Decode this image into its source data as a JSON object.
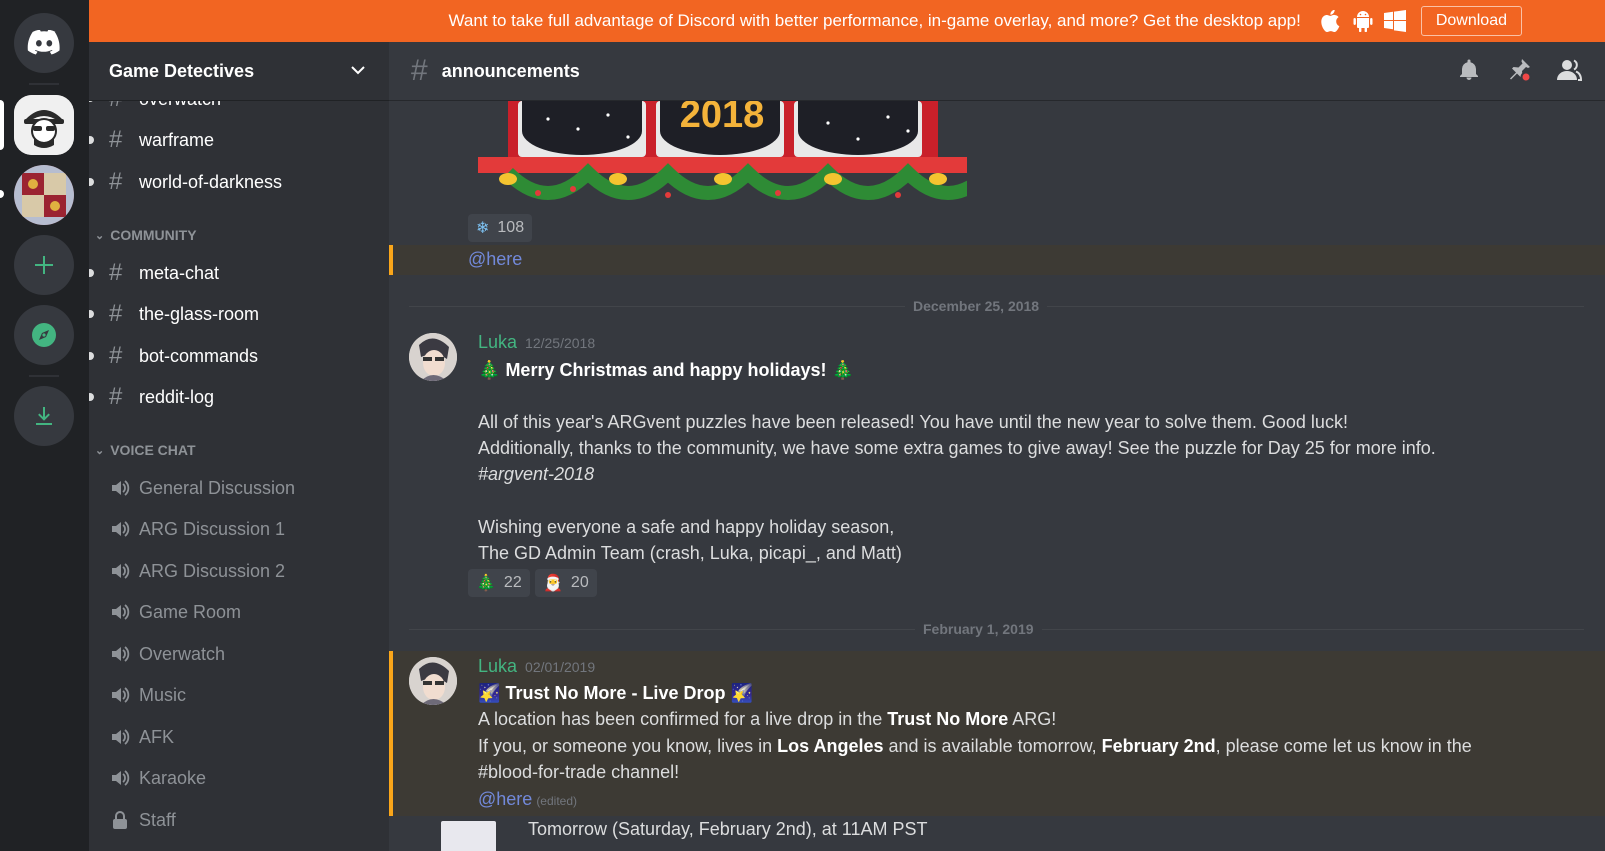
{
  "banner": {
    "text": "Want to take full advantage of Discord with better performance, in-game overlay, and more? Get the desktop app!",
    "download_label": "Download"
  },
  "server": {
    "name": "Game Detectives"
  },
  "channels": {
    "partial_top": "overwatch",
    "text_top": [
      "warframe",
      "world-of-darkness"
    ],
    "community_category": "COMMUNITY",
    "community": [
      "meta-chat",
      "the-glass-room",
      "bot-commands",
      "reddit-log"
    ],
    "voice_category": "VOICE CHAT",
    "voice": [
      "General Discussion",
      "ARG Discussion 1",
      "ARG Discussion 2",
      "Game Room",
      "Overwatch",
      "Music",
      "AFK",
      "Karaoke",
      "Staff"
    ]
  },
  "chat": {
    "channel_name": "announcements",
    "image_text": "2018",
    "reaction_top": {
      "emoji": "❄",
      "count": "108"
    },
    "here_top": "@here",
    "divider1": "December 25, 2018",
    "msg1": {
      "author": "Luka",
      "timestamp": "12/25/2018",
      "title": "Merry Christmas and happy holidays!",
      "emoji_tree": "🎄",
      "line1": "All of this year's ARGvent puzzles have been released! You have until the new year to solve them.  Good luck!",
      "line2": "Additionally, thanks to the community, we have some extra games to give away! See the puzzle for Day 25 for more info.",
      "line3": "#argvent-2018",
      "line4": "Wishing everyone a safe and happy holiday season,",
      "line5": "The GD Admin Team (crash, Luka, picapi_, and Matt)",
      "reactions": [
        {
          "emoji": "🎄",
          "count": "22"
        },
        {
          "emoji": "🎅",
          "count": "20"
        }
      ]
    },
    "divider2": "February 1, 2019",
    "msg2": {
      "author": "Luka",
      "timestamp": "02/01/2019",
      "title": "Trust No More - Live Drop",
      "emoji_shoot": "🌠",
      "l1_a": "A location has been confirmed for a live drop in the ",
      "l1_b": "Trust No More",
      "l1_c": " ARG!",
      "l2_a": "If you, or someone you know, lives in ",
      "l2_b": "Los Angeles",
      "l2_c": " and is available tomorrow, ",
      "l2_d": "February 2nd",
      "l2_e": ", please come let us know in the",
      "l3": "#blood-for-trade channel!",
      "here": "@here",
      "edited": "(edited)"
    },
    "partial_bottom": "Tomorrow (Saturday, February 2nd), at 11AM PST"
  }
}
